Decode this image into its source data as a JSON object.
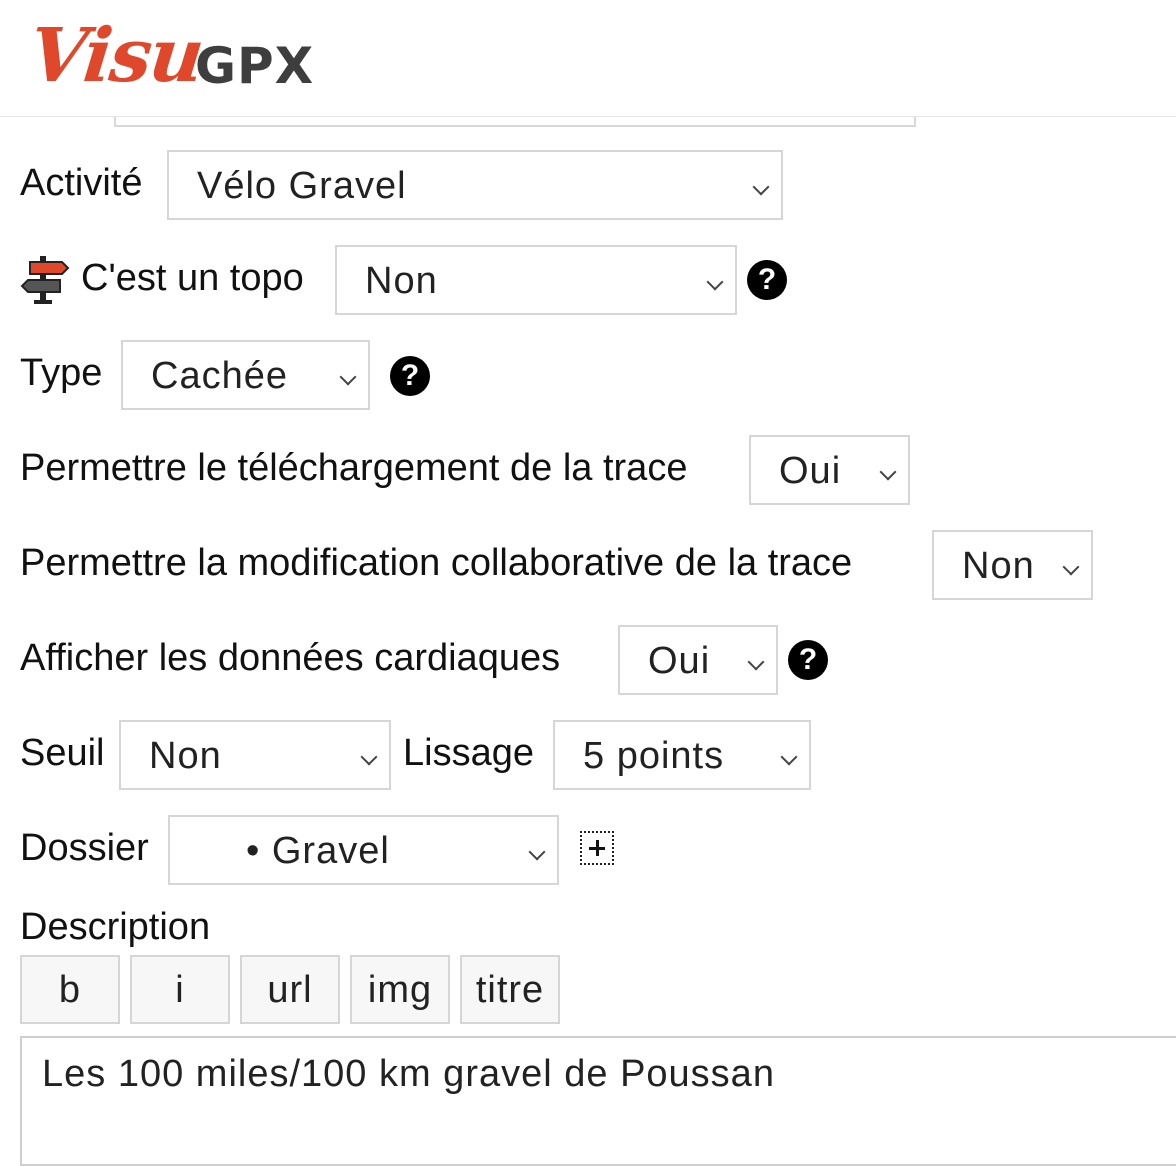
{
  "header": {
    "logo_script": "Visu",
    "logo_block": "GPX"
  },
  "form": {
    "activity": {
      "label": "Activité",
      "value": "Vélo Gravel"
    },
    "topo": {
      "label": "C'est un topo",
      "value": "Non",
      "icon": "signpost-icon",
      "help": "?"
    },
    "type": {
      "label": "Type",
      "value": "Cachée",
      "help": "?"
    },
    "download": {
      "label": "Permettre le téléchargement de la trace",
      "value": "Oui"
    },
    "collab": {
      "label": "Permettre la modification collaborative de la trace",
      "value": "Non"
    },
    "cardiac": {
      "label": "Afficher les données cardiaques",
      "value": "Oui",
      "help": "?"
    },
    "threshold": {
      "label": "Seuil",
      "value": "Non"
    },
    "smoothing": {
      "label": "Lissage",
      "value": "5 points"
    },
    "folder": {
      "label": "Dossier",
      "value": "• Gravel",
      "add_icon": "plus-icon"
    },
    "description": {
      "label": "Description",
      "toolbar": [
        "b",
        "i",
        "url",
        "img",
        "titre"
      ],
      "text": "Les 100 miles/100 km gravel de Poussan"
    }
  },
  "colors": {
    "brand_red": "#e0482c",
    "brand_gray": "#3e3e3e",
    "border": "#d6d6d6"
  }
}
